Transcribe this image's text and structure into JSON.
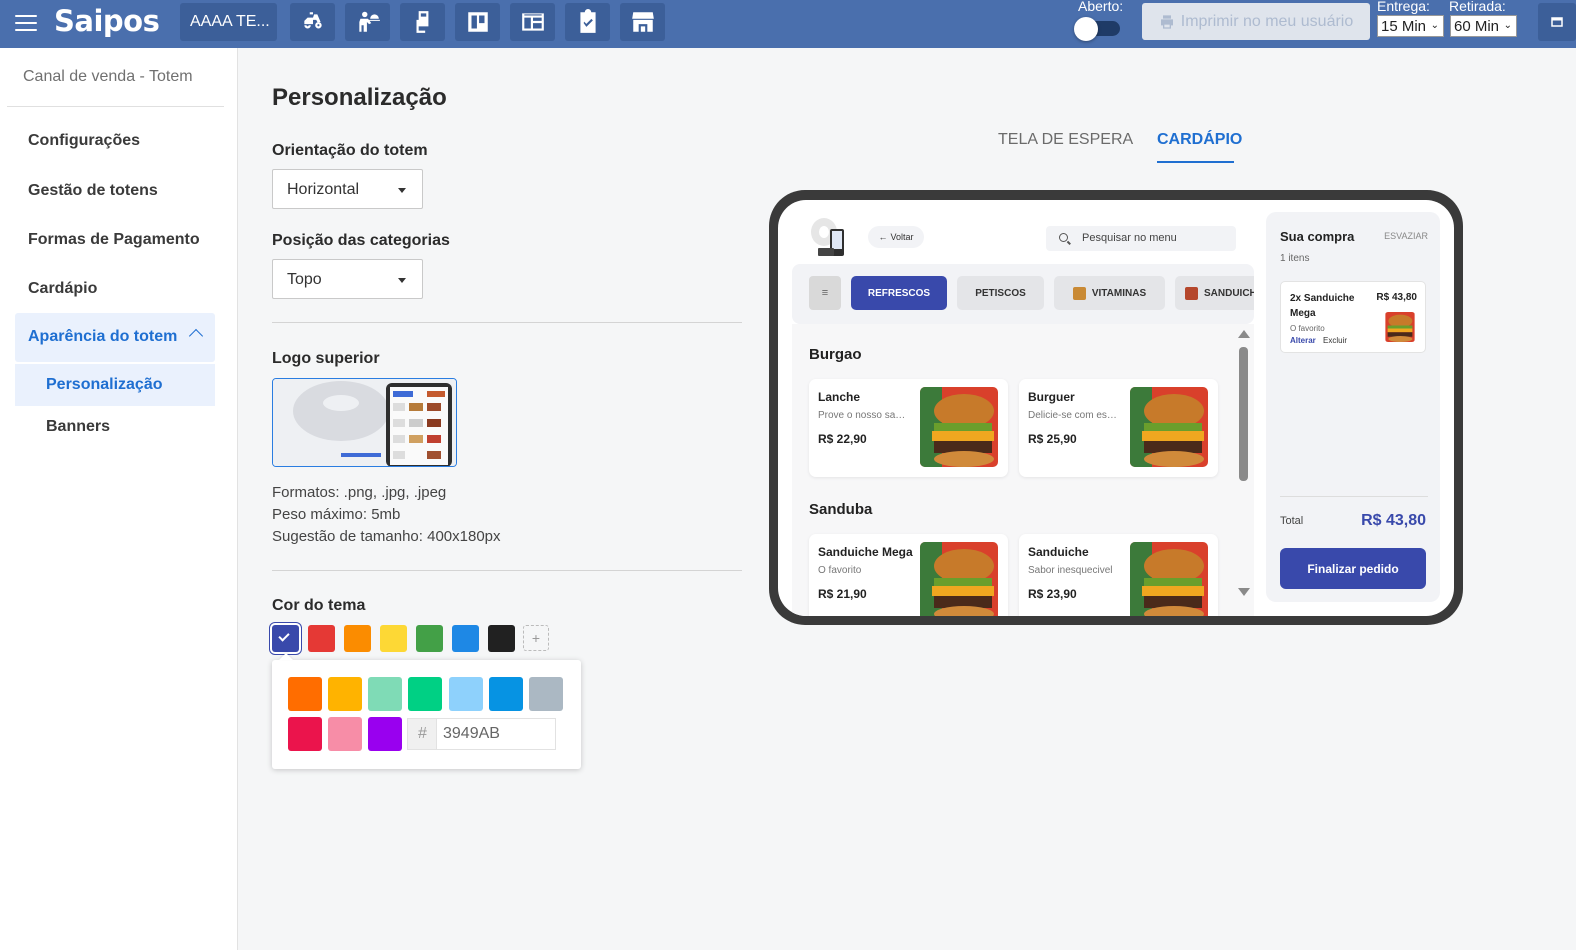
{
  "topbar": {
    "logo_text": "Saipos",
    "store_name": "AAAA TE...",
    "nav_icons": [
      "delivery-scooter-icon",
      "waiter-serving-icon",
      "hand-card-icon",
      "kanban-board-icon",
      "layout-panel-icon",
      "clipboard-check-icon",
      "storefront-icon"
    ],
    "open_label": "Aberto:",
    "print_label": "Imprimir no meu usuário",
    "delivery_label": "Entrega:",
    "delivery_value": "15 Min",
    "pickup_label": "Retirada:",
    "pickup_value": "60 Min"
  },
  "sidebar": {
    "header": "Canal de venda - Totem",
    "items": [
      {
        "label": "Configurações"
      },
      {
        "label": "Gestão de totens"
      },
      {
        "label": "Formas de Pagamento"
      },
      {
        "label": "Cardápio"
      }
    ],
    "active_group": "Aparência do totem",
    "sub_items": [
      {
        "label": "Personalização"
      },
      {
        "label": "Banners"
      }
    ]
  },
  "main": {
    "title": "Personalização",
    "orientation": {
      "label": "Orientação do totem",
      "value": "Horizontal"
    },
    "category_position": {
      "label": "Posição das categorias",
      "value": "Topo"
    },
    "logo": {
      "label": "Logo superior",
      "formats": "Formatos: .png, .jpg, .jpeg",
      "max_weight": "Peso máximo: 5mb",
      "size_hint": "Sugestão de tamanho: 400x180px"
    },
    "theme": {
      "label": "Cor do tema",
      "selected_color": "#3949AB",
      "swatches": [
        "#3949AB",
        "#E53935",
        "#FB8C00",
        "#FDD835",
        "#43A047",
        "#1E88E5",
        "#212121"
      ],
      "add_symbol": "+",
      "picker_colors": [
        "#FF6D00",
        "#FFB300",
        "#7FDBB6",
        "#00D084",
        "#8ED1FC",
        "#0693E3",
        "#ABB8C3",
        "#EB144C",
        "#F78DA7",
        "#9900EF"
      ],
      "hex_prefix": "#",
      "hex_value": "3949AB"
    }
  },
  "preview": {
    "tabs": [
      {
        "label": "TELA DE ESPERA",
        "active": false
      },
      {
        "label": "CARDÁPIO",
        "active": true
      }
    ],
    "back_label": "Voltar",
    "search_placeholder": "Pesquisar no menu",
    "menu_symbol": "≡",
    "categories": [
      {
        "label": "REFRESCOS",
        "active": true
      },
      {
        "label": "PETISCOS",
        "active": false
      },
      {
        "label": "VITAMINAS",
        "active": false
      },
      {
        "label": "SANDUICHES",
        "active": false
      }
    ],
    "sections": [
      {
        "title": "Burgao",
        "items": [
          {
            "name": "Lanche",
            "desc": "Prove o nosso sanduíche",
            "price": "R$ 22,90"
          },
          {
            "name": "Burguer",
            "desc": "Delicie-se com esse burguer",
            "price": "R$ 25,90"
          }
        ]
      },
      {
        "title": "Sanduba",
        "items": [
          {
            "name": "Sanduiche Mega",
            "desc": "O favorito",
            "price": "R$ 21,90"
          },
          {
            "name": "Sanduiche",
            "desc": "Sabor inesquecivel",
            "price": "R$ 23,90"
          }
        ]
      }
    ],
    "cart": {
      "title": "Sua compra",
      "empty_label": "ESVAZIAR",
      "count": "1 itens",
      "item": {
        "name": "2x Sanduiche Mega",
        "price": "R$ 43,80",
        "note": "O favorito",
        "edit": "Alterar",
        "remove": "Excluir"
      },
      "total_label": "Total",
      "total_value": "R$ 43,80",
      "finish_label": "Finalizar pedido"
    }
  }
}
